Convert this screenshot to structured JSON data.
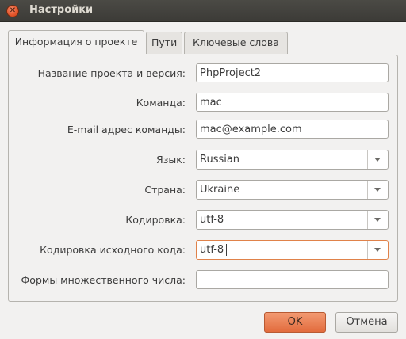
{
  "window": {
    "title": "Настройки",
    "close_icon": "close-icon",
    "close_glyph": "✕"
  },
  "tabs": [
    {
      "label": "Информация о проекте",
      "active": true
    },
    {
      "label": "Пути",
      "active": false
    },
    {
      "label": "Ключевые слова",
      "active": false
    }
  ],
  "form": {
    "project_name": {
      "label": "Название проекта и версия:",
      "value": "PhpProject2"
    },
    "team": {
      "label": "Команда:",
      "value": "mac"
    },
    "team_email": {
      "label": "E-mail адрес команды:",
      "value": "mac@example.com"
    },
    "language": {
      "label": "Язык:",
      "value": "Russian"
    },
    "country": {
      "label": "Страна:",
      "value": "Ukraine"
    },
    "encoding": {
      "label": "Кодировка:",
      "value": "utf-8"
    },
    "source_encoding": {
      "label": "Кодировка исходного кода:",
      "value": "utf-8"
    },
    "plural_forms": {
      "label": "Формы множественного числа:",
      "value": ""
    }
  },
  "buttons": {
    "ok": "OK",
    "cancel": "Отмена"
  },
  "colors": {
    "accent": "#e26b3d",
    "titlebar": "#3c3b37",
    "window_bg": "#f2f1f0"
  }
}
